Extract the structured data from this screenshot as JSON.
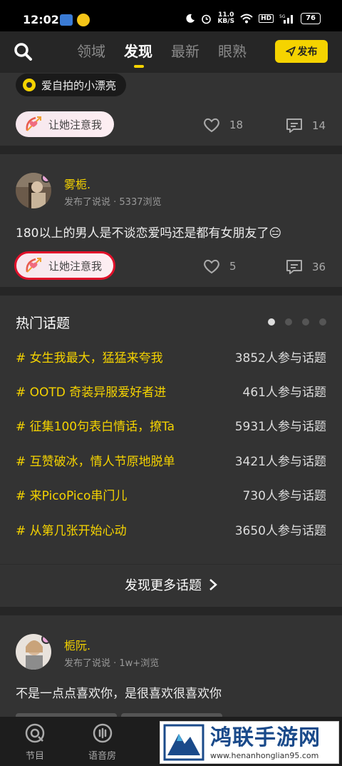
{
  "status_bar": {
    "time": "12:02",
    "net_speed_top": "11.0",
    "net_speed_bottom": "KB/S",
    "hd": "HD",
    "signal": "5G",
    "battery": "76"
  },
  "top_nav": {
    "tabs": [
      "领域",
      "发现",
      "最新",
      "眼熟"
    ],
    "active_tab": "发现",
    "publish_label": "发布"
  },
  "post1": {
    "topic_tag": "爱自拍的小漂亮",
    "notice_label": "让她注意我",
    "likes": "18",
    "comments": "14"
  },
  "post2": {
    "username": "雾栀.",
    "meta": "发布了说说 · 5337浏览",
    "text": "180以上的男人是不谈恋爱吗还是都有女朋友了😑",
    "notice_label": "让她注意我",
    "likes": "5",
    "comments": "36"
  },
  "hot_topics": {
    "title": "热门话题",
    "items": [
      {
        "name": "# 女生我最大，猛猛来夸我",
        "count": "3852人参与话题"
      },
      {
        "name": "# OOTD 奇装异服爱好者进",
        "count": "461人参与话题"
      },
      {
        "name": "# 征集100句表白情话，撩Ta",
        "count": "5931人参与话题"
      },
      {
        "name": "# 互赞破冰，情人节原地脱单",
        "count": "3421人参与话题"
      },
      {
        "name": "# 来PicoPico串门儿",
        "count": "730人参与话题"
      },
      {
        "name": "# 从第几张开始心动",
        "count": "3650人参与话题"
      }
    ],
    "more_label": "发现更多话题"
  },
  "post3": {
    "username": "栀阮.",
    "meta": "发布了说说 · 1w+浏览",
    "text": "不是一点点喜欢你，是很喜欢很喜欢你"
  },
  "bottom_nav": {
    "items": [
      "节目",
      "语音房"
    ]
  },
  "watermark": {
    "title": "鸿联手游网",
    "url": "www.henanhonglian95.com"
  },
  "colors": {
    "accent": "#f5d300",
    "background": "#262626",
    "card": "#333333",
    "highlight_border": "#e0102a"
  }
}
